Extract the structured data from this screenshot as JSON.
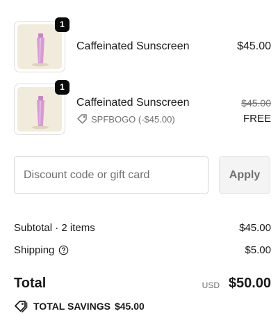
{
  "line_items": [
    {
      "name": "Caffeinated Sunscreen",
      "quantity": "1",
      "price": "$45.00",
      "image_icon": "sunscreen-tube-icon"
    },
    {
      "name": "Caffeinated Sunscreen",
      "quantity": "1",
      "compare_price": "$45.00",
      "price": "FREE",
      "discount_code": "SPFBOGO (-$45.00)",
      "image_icon": "sunscreen-tube-icon"
    }
  ],
  "discount": {
    "placeholder": "Discount code or gift card",
    "value": "",
    "apply_label": "Apply"
  },
  "summary": {
    "subtotal_label": "Subtotal · 2 items",
    "subtotal_value": "$45.00",
    "shipping_label": "Shipping",
    "shipping_value": "$5.00",
    "total_label": "Total",
    "currency": "USD",
    "total_value": "$50.00",
    "savings_label": "TOTAL SAVINGS",
    "savings_value": "$45.00"
  },
  "colors": {
    "text": "#1a1a1a",
    "muted": "#707070",
    "badge": "#0a0a0a",
    "thumb_bg": "#f1ebdb",
    "tube": "#d79ad6",
    "input_border": "#d6d6d6",
    "button_bg": "#f4f4f4"
  }
}
